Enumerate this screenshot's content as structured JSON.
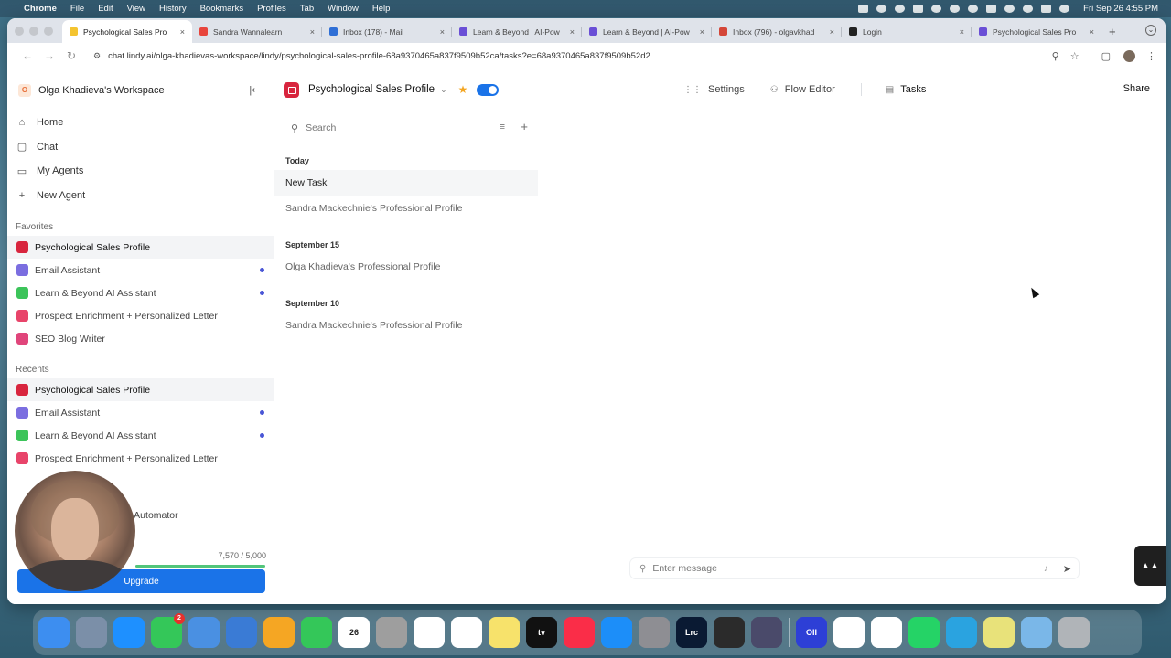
{
  "menubar": {
    "app": "Chrome",
    "items": [
      "File",
      "Edit",
      "View",
      "History",
      "Bookmarks",
      "Profiles",
      "Tab",
      "Window",
      "Help"
    ],
    "clock": "Fri Sep 26  4:55 PM"
  },
  "tabs": [
    {
      "title": "Psychological Sales Pro",
      "color": "#f4c430",
      "active": true
    },
    {
      "title": "Sandra Wannalearn",
      "color": "#e8453c"
    },
    {
      "title": "Inbox (178) - Mail",
      "color": "#2f6fd6"
    },
    {
      "title": "Learn & Beyond | AI-Pow",
      "color": "#6a4fd6"
    },
    {
      "title": "Learn & Beyond | AI-Pow",
      "color": "#6a4fd6"
    },
    {
      "title": "Inbox (796) - olgavkhad",
      "color": "#d44638"
    },
    {
      "title": "Login",
      "color": "#222"
    },
    {
      "title": "Psychological Sales Pro",
      "color": "#6a4fd6"
    }
  ],
  "url": "chat.lindy.ai/olga-khadievas-workspace/lindy/psychological-sales-profile-68a9370465a837f9509b52ca/tasks?e=68a9370465a837f9509b52d2",
  "sidebar": {
    "workspace": "Olga Khadieva's Workspace",
    "workspace_initial": "O",
    "nav": [
      {
        "label": "Home",
        "icon": "⌂"
      },
      {
        "label": "Chat",
        "icon": "▢"
      },
      {
        "label": "My Agents",
        "icon": "▭"
      },
      {
        "label": "New Agent",
        "icon": "+"
      }
    ],
    "favorites_label": "Favorites",
    "favorites": [
      {
        "label": "Psychological Sales Profile",
        "color": "#d8253e",
        "selected": true,
        "dot": false
      },
      {
        "label": "Email Assistant",
        "color": "#7b6ee0",
        "dot": true
      },
      {
        "label": "Learn & Beyond AI Assistant",
        "color": "#3cc45a",
        "dot": true
      },
      {
        "label": "Prospect Enrichment + Personalized Letter",
        "color": "#e8446a",
        "dot": false
      },
      {
        "label": "SEO Blog Writer",
        "color": "#e0457b",
        "dot": false
      }
    ],
    "recents_label": "Recents",
    "recents": [
      {
        "label": "Psychological Sales Profile",
        "color": "#d8253e",
        "selected": true,
        "dot": false
      },
      {
        "label": "Email Assistant",
        "color": "#7b6ee0",
        "dot": true
      },
      {
        "label": "Learn & Beyond AI Assistant",
        "color": "#3cc45a",
        "dot": true
      },
      {
        "label": "Prospect Enrichment + Personalized Letter",
        "color": "#e8446a",
        "dot": false
      }
    ],
    "partial_item": "e Automator",
    "credits": "7,570 / 5,000",
    "credits_fill_fraction": 1.0,
    "upgrade": "Upgrade"
  },
  "header": {
    "title": "Psychological Sales Profile",
    "tabs": [
      {
        "label": "Settings",
        "icon": "⋮⋮"
      },
      {
        "label": "Flow Editor",
        "icon": "⚇"
      },
      {
        "label": "Tasks",
        "icon": "▤",
        "active": true
      }
    ],
    "share": "Share"
  },
  "tasks": {
    "search_placeholder": "Search",
    "groups": [
      {
        "label": "Today",
        "items": [
          {
            "label": "New Task",
            "selected": true
          },
          {
            "label": "Sandra Mackechnie's Professional Profile"
          }
        ]
      },
      {
        "label": "September 15",
        "items": [
          {
            "label": "Olga Khadieva's Professional Profile"
          }
        ]
      },
      {
        "label": "September 10",
        "items": [
          {
            "label": "Sandra Mackechnie's Professional Profile"
          }
        ]
      }
    ]
  },
  "composer": {
    "placeholder": "Enter message"
  },
  "dock": [
    {
      "color": "#3d8ef0"
    },
    {
      "color": "#7b8fa8"
    },
    {
      "color": "#1e90ff"
    },
    {
      "color": "#34c759",
      "badge": "2"
    },
    {
      "color": "#4a90e2"
    },
    {
      "color": "#3a7bd5"
    },
    {
      "color": "#f5a623"
    },
    {
      "color": "#34c759"
    },
    {
      "color": "#ffffff",
      "label": "26",
      "dark": true
    },
    {
      "color": "#9e9e9e"
    },
    {
      "color": "#ffffff"
    },
    {
      "color": "#ffffff"
    },
    {
      "color": "#f7e26b"
    },
    {
      "color": "#111111",
      "label": "tv"
    },
    {
      "color": "#fa2d48"
    },
    {
      "color": "#1c8ef9"
    },
    {
      "color": "#8e8e93"
    },
    {
      "color": "#0a1a33",
      "label": "Lrc"
    },
    {
      "color": "#2b2b2b"
    },
    {
      "color": "#4a4a6a"
    },
    {
      "color": "#2d3fd6",
      "label": "OII"
    },
    {
      "color": "#ffffff"
    },
    {
      "color": "#ffffff"
    },
    {
      "color": "#25d366"
    },
    {
      "color": "#2aa3e0"
    },
    {
      "color": "#e8e27a"
    },
    {
      "color": "#7ab7e8"
    },
    {
      "color": "#b0b4b8"
    }
  ]
}
